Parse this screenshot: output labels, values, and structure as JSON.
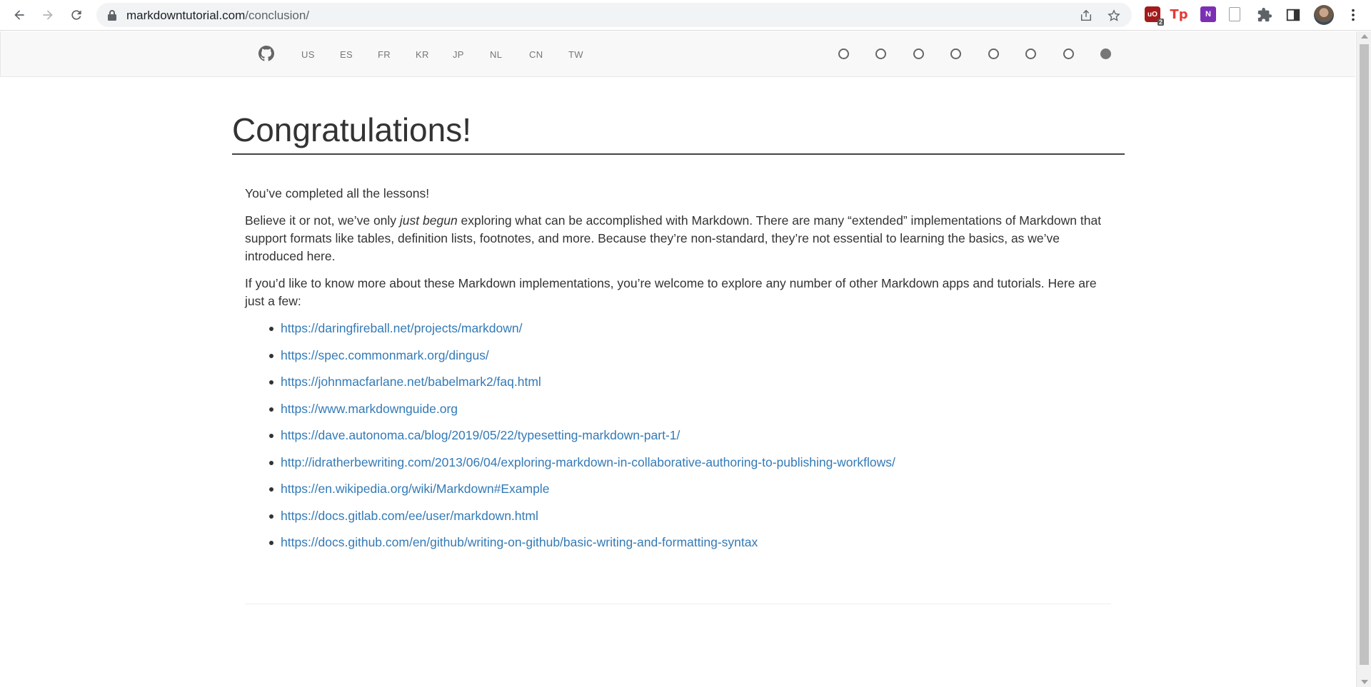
{
  "browser": {
    "url_host": "markdowntutorial.com",
    "url_path": "/conclusion/",
    "extension_badge": "2",
    "ext_tp_label": "Tp",
    "ext_onenote_label": "N",
    "ext_ublock_label": "uO"
  },
  "nav": {
    "languages": [
      "US",
      "ES",
      "FR",
      "KR",
      "JP",
      "NL",
      "CN",
      "TW"
    ],
    "lesson_dots_count": 8,
    "active_dot_index": 7
  },
  "page": {
    "title": "Congratulations!",
    "p1": "You’ve completed all the lessons!",
    "p2_before": "Believe it or not, we’ve only ",
    "p2_em": "just begun",
    "p2_after": " exploring what can be accomplished with Markdown. There are many “extended” implementations of Markdown that support formats like tables, definition lists, footnotes, and more. Because they’re non-standard, they’re not essential to learning the basics, as we’ve introduced here.",
    "p3": "If you’d like to know more about these Markdown implementations, you’re welcome to explore any number of other Markdown apps and tutorials. Here are just a few:",
    "links": [
      "https://daringfireball.net/projects/markdown/",
      "https://spec.commonmark.org/dingus/",
      "https://johnmacfarlane.net/babelmark2/faq.html",
      "https://www.markdownguide.org",
      "https://dave.autonoma.ca/blog/2019/05/22/typesetting-markdown-part-1/",
      "http://idratherbewriting.com/2013/06/04/exploring-markdown-in-collaborative-authoring-to-publishing-workflows/",
      "https://en.wikipedia.org/wiki/Markdown#Example",
      "https://docs.gitlab.com/ee/user/markdown.html",
      "https://docs.github.com/en/github/writing-on-github/basic-writing-and-formatting-syntax"
    ]
  },
  "colors": {
    "link": "#337ab7",
    "text": "#333333",
    "nav_bg": "#f8f8f8"
  }
}
